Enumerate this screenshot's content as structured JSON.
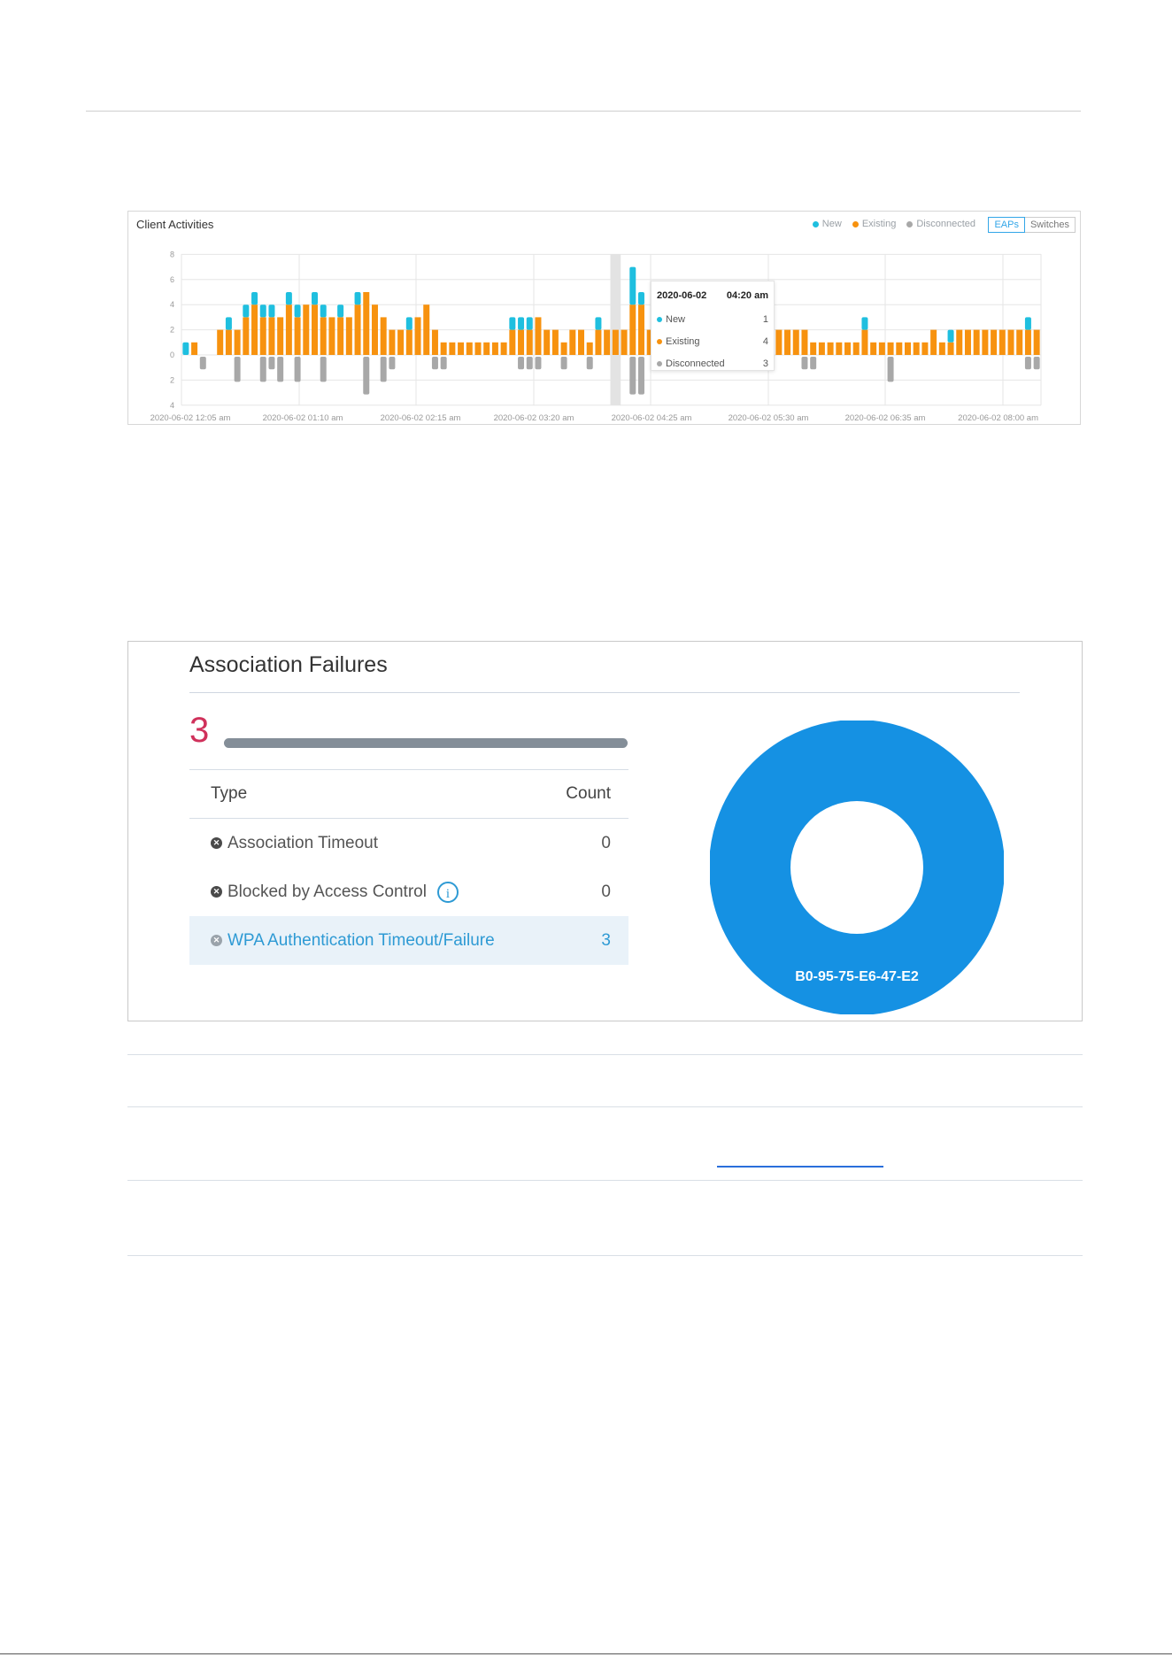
{
  "client_activities": {
    "title": "Client Activities",
    "legend": [
      {
        "label": "New",
        "color": "#1fbfdf"
      },
      {
        "label": "Existing",
        "color": "#f7920f"
      },
      {
        "label": "Disconnected",
        "color": "#a8a8a8"
      }
    ],
    "tabs": [
      {
        "label": "EAPs",
        "active": true
      },
      {
        "label": "Switches",
        "active": false
      }
    ],
    "tooltip": {
      "date": "2020-06-02",
      "time": "04:20 am",
      "rows": [
        {
          "label": "New",
          "value": "1",
          "color": "#1fbfdf"
        },
        {
          "label": "Existing",
          "value": "4",
          "color": "#f7920f"
        },
        {
          "label": "Disconnected",
          "value": "3",
          "color": "#a8a8a8"
        }
      ]
    }
  },
  "chart_data": {
    "type": "bar",
    "title": "Client Activities",
    "y_ticks": [
      "8",
      "6",
      "4",
      "2",
      "0",
      "2",
      "4"
    ],
    "ylim": [
      -4,
      8
    ],
    "x_tick_labels": [
      "2020-06-02 12:05 am",
      "2020-06-02 01:10 am",
      "2020-06-02 02:15 am",
      "2020-06-02 03:20 am",
      "2020-06-02 04:25 am",
      "2020-06-02 05:30 am",
      "2020-06-02 06:35 am",
      "2020-06-02 08:00 am"
    ],
    "highlight_index": 50,
    "series": [
      {
        "name": "Existing",
        "color": "#f7920f",
        "values": [
          0,
          1,
          0,
          0,
          2,
          2,
          2,
          3,
          4,
          3,
          3,
          3,
          4,
          3,
          4,
          4,
          3,
          3,
          3,
          3,
          4,
          5,
          4,
          3,
          2,
          2,
          2,
          3,
          4,
          2,
          1,
          1,
          1,
          1,
          1,
          1,
          1,
          1,
          2,
          2,
          2,
          3,
          2,
          2,
          1,
          2,
          2,
          1,
          2,
          2,
          2,
          2,
          4,
          4,
          2,
          2,
          3,
          2,
          2,
          2,
          2,
          2,
          2,
          2,
          2,
          2,
          2,
          2,
          2,
          2,
          2,
          2,
          2,
          1,
          1,
          1,
          1,
          1,
          1,
          2,
          1,
          1,
          1,
          1,
          1,
          1,
          1,
          2,
          1,
          1,
          2,
          2,
          2,
          2,
          2,
          2,
          2,
          2,
          2,
          2
        ]
      },
      {
        "name": "New",
        "color": "#1fbfdf",
        "values": [
          1,
          0,
          0,
          0,
          0,
          1,
          0,
          1,
          1,
          1,
          1,
          0,
          1,
          1,
          0,
          1,
          1,
          0,
          1,
          0,
          1,
          0,
          0,
          0,
          0,
          0,
          1,
          0,
          0,
          0,
          0,
          0,
          0,
          0,
          0,
          0,
          0,
          0,
          1,
          1,
          1,
          0,
          0,
          0,
          0,
          0,
          0,
          0,
          1,
          0,
          0,
          0,
          3,
          1,
          0,
          0,
          0,
          0,
          0,
          0,
          0,
          0,
          0,
          0,
          0,
          0,
          0,
          0,
          0,
          0,
          0,
          0,
          0,
          0,
          0,
          0,
          0,
          0,
          0,
          1,
          0,
          0,
          0,
          0,
          0,
          0,
          0,
          0,
          0,
          1,
          0,
          0,
          0,
          0,
          0,
          0,
          0,
          0,
          1,
          0
        ]
      },
      {
        "name": "Disconnected",
        "color": "#a8a8a8",
        "values": [
          0,
          0,
          1,
          0,
          0,
          0,
          2,
          0,
          0,
          2,
          1,
          2,
          0,
          2,
          0,
          0,
          2,
          0,
          0,
          0,
          0,
          3,
          0,
          2,
          1,
          0,
          0,
          0,
          0,
          1,
          1,
          0,
          0,
          0,
          0,
          0,
          0,
          0,
          0,
          1,
          1,
          1,
          0,
          0,
          1,
          0,
          0,
          1,
          0,
          0,
          0,
          0,
          3,
          3,
          0,
          0,
          0,
          0,
          0,
          0,
          0,
          0,
          0,
          0,
          0,
          0,
          0,
          0,
          0,
          0,
          0,
          0,
          1,
          1,
          0,
          0,
          0,
          0,
          0,
          0,
          0,
          0,
          2,
          0,
          0,
          0,
          0,
          0,
          0,
          0,
          0,
          0,
          0,
          0,
          0,
          0,
          0,
          0,
          1,
          1
        ]
      }
    ]
  },
  "association_failures": {
    "title": "Association Failures",
    "total": "3",
    "bar_fraction": 1.0,
    "table": {
      "header_type": "Type",
      "header_count": "Count",
      "rows": [
        {
          "type": "Association Timeout",
          "count": "0",
          "selected": false,
          "info": false
        },
        {
          "type": "Blocked by Access Control",
          "count": "0",
          "selected": false,
          "info": true
        },
        {
          "type": "WPA Authentication Timeout/Failure",
          "count": "3",
          "selected": true,
          "info": false
        }
      ]
    },
    "donut": {
      "label": "B0-95-75-E6-47-E2",
      "value": 3,
      "color": "#1591e3"
    }
  }
}
